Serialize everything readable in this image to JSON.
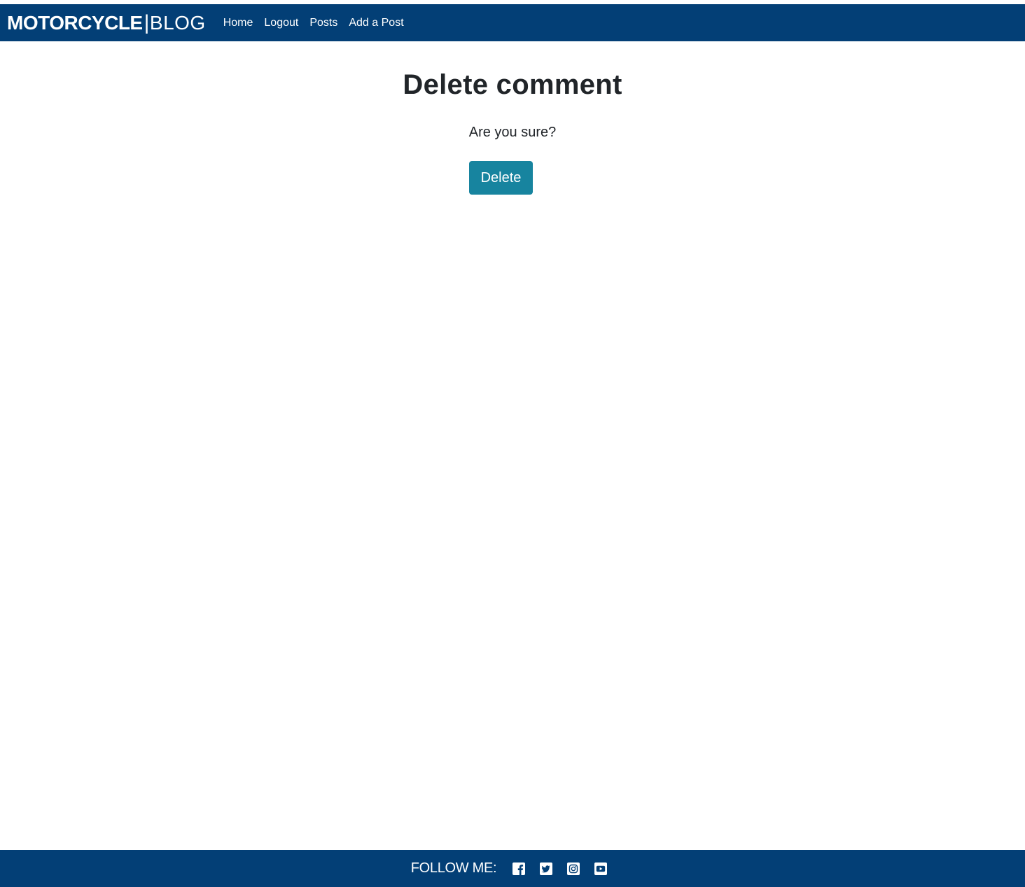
{
  "navbar": {
    "brand_bold": "MOTORCYCLE",
    "brand_separator": "|",
    "brand_light": "BLOG",
    "links": [
      {
        "label": "Home"
      },
      {
        "label": "Logout"
      },
      {
        "label": "Posts"
      },
      {
        "label": "Add a Post"
      }
    ]
  },
  "main": {
    "title": "Delete comment",
    "prompt": "Are you sure?",
    "delete_label": "Delete"
  },
  "footer": {
    "follow_label": "FOLLOW ME:",
    "icons": [
      "facebook-icon",
      "twitter-icon",
      "instagram-icon",
      "youtube-icon"
    ]
  },
  "colors": {
    "navbar_bg": "#033f76",
    "button_bg": "#17849f",
    "text": "#212529"
  }
}
